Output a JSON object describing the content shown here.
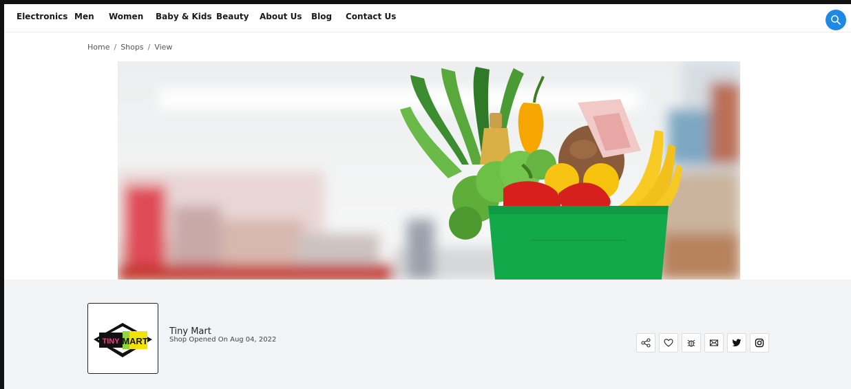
{
  "nav": {
    "items": [
      "Electronics",
      "Men",
      "Women",
      "Baby & Kids",
      "Beauty",
      "About Us",
      "Blog",
      "Contact Us"
    ]
  },
  "breadcrumb": {
    "home": "Home",
    "shops": "Shops",
    "current": "View"
  },
  "shop": {
    "name": "Tiny Mart",
    "opened": "Shop Opened On Aug 04, 2022",
    "logo_text_left": "TINY",
    "logo_text_right": "MART"
  },
  "social_icons": [
    "share-icon",
    "heart-icon",
    "bug-icon",
    "mail-icon",
    "twitter-icon",
    "instagram-icon"
  ],
  "colors": {
    "accent": "#1e88e5",
    "section_bg": "#f2f3f5",
    "bag_green": "#12a94a"
  }
}
